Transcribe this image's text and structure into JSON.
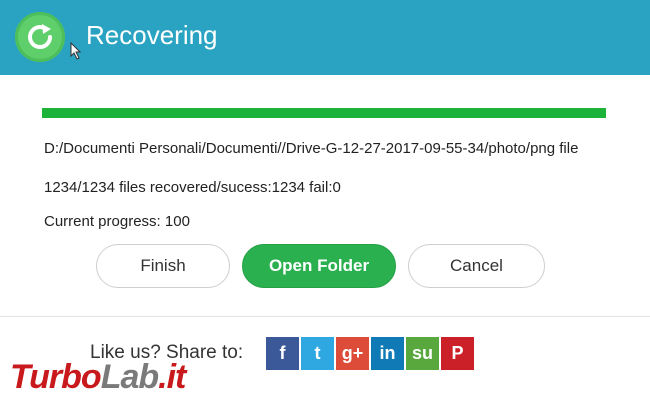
{
  "header": {
    "title": "Recovering",
    "bg_color": "#2aa3c3"
  },
  "progress": {
    "value": 100,
    "color": "#1db33b"
  },
  "status": {
    "path": "D:/Documenti Personali/Documenti//Drive-G-12-27-2017-09-55-34/photo/png file",
    "files": "1234/1234 files recovered/sucess:1234 fail:0",
    "current_progress": "Current progress: 100"
  },
  "buttons": {
    "finish": "Finish",
    "open_folder": "Open Folder",
    "cancel": "Cancel"
  },
  "share": {
    "label": "Like us? Share to:",
    "icons": [
      {
        "name": "facebook-icon",
        "glyph": "f",
        "color": "#3b5998"
      },
      {
        "name": "twitter-icon",
        "glyph": "t",
        "color": "#2fa8e1"
      },
      {
        "name": "google-plus-icon",
        "glyph": "g+",
        "color": "#dd4b39"
      },
      {
        "name": "linkedin-icon",
        "glyph": "in",
        "color": "#0f7ab6"
      },
      {
        "name": "stumbleupon-icon",
        "glyph": "su",
        "color": "#58a83e"
      },
      {
        "name": "pinterest-icon",
        "glyph": "P",
        "color": "#cb2027"
      }
    ]
  },
  "watermark": {
    "part1": "Turbo",
    "part2": "Lab",
    "part3": ".it"
  }
}
